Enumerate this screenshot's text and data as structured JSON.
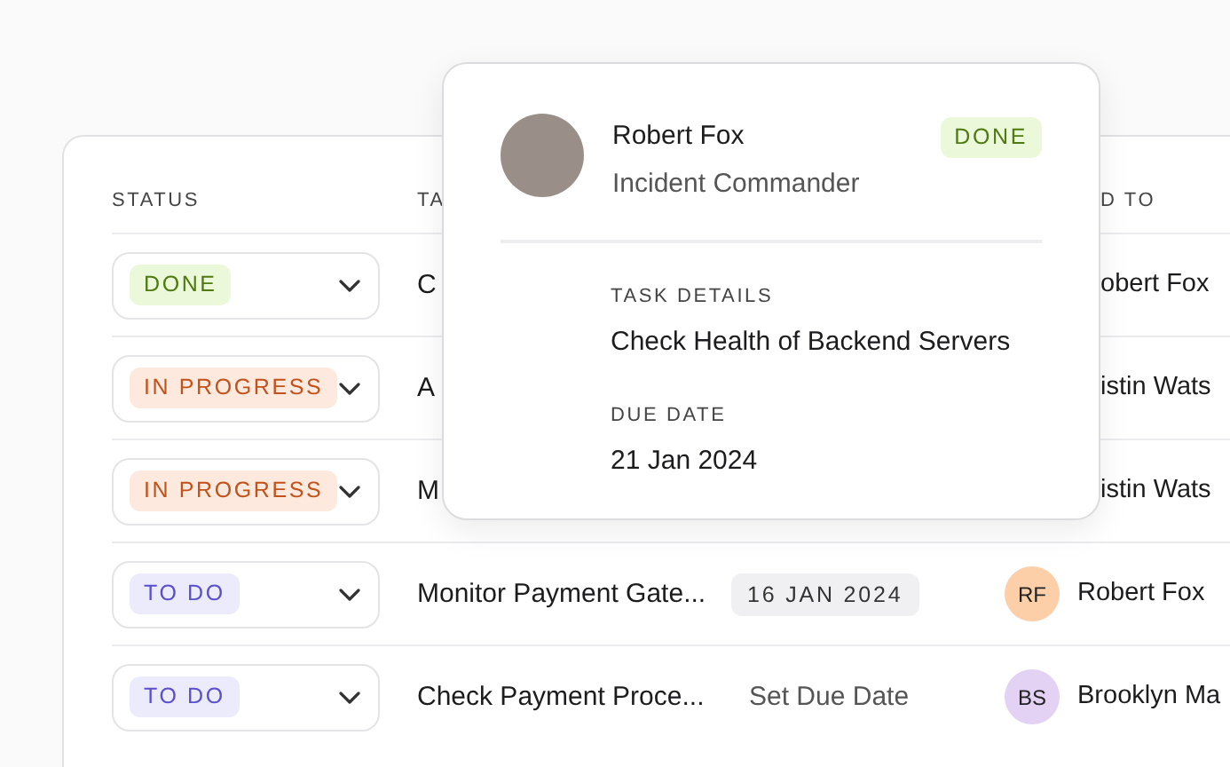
{
  "table": {
    "columns": [
      {
        "label": "STATUS",
        "kind": "status"
      },
      {
        "label": "TA",
        "kind": "task"
      },
      {
        "label": "D TO",
        "kind": "assignee"
      }
    ],
    "rows": [
      {
        "status": {
          "label": "DONE",
          "kind": "done"
        },
        "task": "C",
        "assignee": {
          "name": "obert Fox"
        }
      },
      {
        "status": {
          "label": "IN PROGRESS",
          "kind": "progress"
        },
        "task": "A",
        "assignee": {
          "name": "istin Wats"
        }
      },
      {
        "status": {
          "label": "IN PROGRESS",
          "kind": "progress"
        },
        "task": "M",
        "assignee": {
          "name": "istin Wats"
        }
      },
      {
        "status": {
          "label": "TO DO",
          "kind": "todo"
        },
        "task": "Monitor Payment Gate...",
        "due": {
          "text": "16 JAN 2024",
          "kind": "date"
        },
        "assignee": {
          "initials": "RF",
          "color": "#fdcfa8",
          "name": "Robert Fox"
        }
      },
      {
        "status": {
          "label": "TO DO",
          "kind": "todo"
        },
        "task": "Check Payment Proce...",
        "due": {
          "text": "Set Due Date",
          "kind": "unset"
        },
        "assignee": {
          "initials": "BS",
          "color": "#e3d2f3",
          "name": "Brooklyn Ma"
        }
      }
    ]
  },
  "popover": {
    "name": "Robert Fox",
    "role": "Incident Commander",
    "status": {
      "label": "DONE",
      "kind": "done"
    },
    "fields": [
      {
        "label": "TASK DETAILS",
        "value": "Check Health of Backend Servers"
      },
      {
        "label": "DUE DATE",
        "value": "21 Jan 2024"
      }
    ]
  }
}
